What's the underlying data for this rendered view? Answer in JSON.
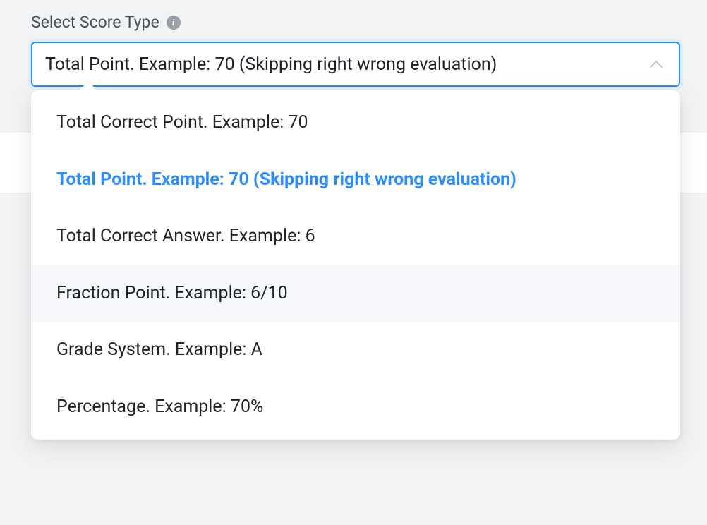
{
  "field": {
    "label": "Select Score Type",
    "info_icon": "i",
    "selected_value": "Total Point. Example: 70 (Skipping right wrong evaluation)"
  },
  "dropdown": {
    "options": [
      {
        "label": "Total Correct Point. Example: 70",
        "selected": false,
        "hovered": false
      },
      {
        "label": "Total Point. Example: 70 (Skipping right wrong evaluation)",
        "selected": true,
        "hovered": false
      },
      {
        "label": "Total Correct Answer. Example: 6",
        "selected": false,
        "hovered": false
      },
      {
        "label": "Fraction Point. Example: 6/10",
        "selected": false,
        "hovered": true
      },
      {
        "label": "Grade System. Example: A",
        "selected": false,
        "hovered": false
      },
      {
        "label": "Percentage. Example: 70%",
        "selected": false,
        "hovered": false
      }
    ]
  }
}
